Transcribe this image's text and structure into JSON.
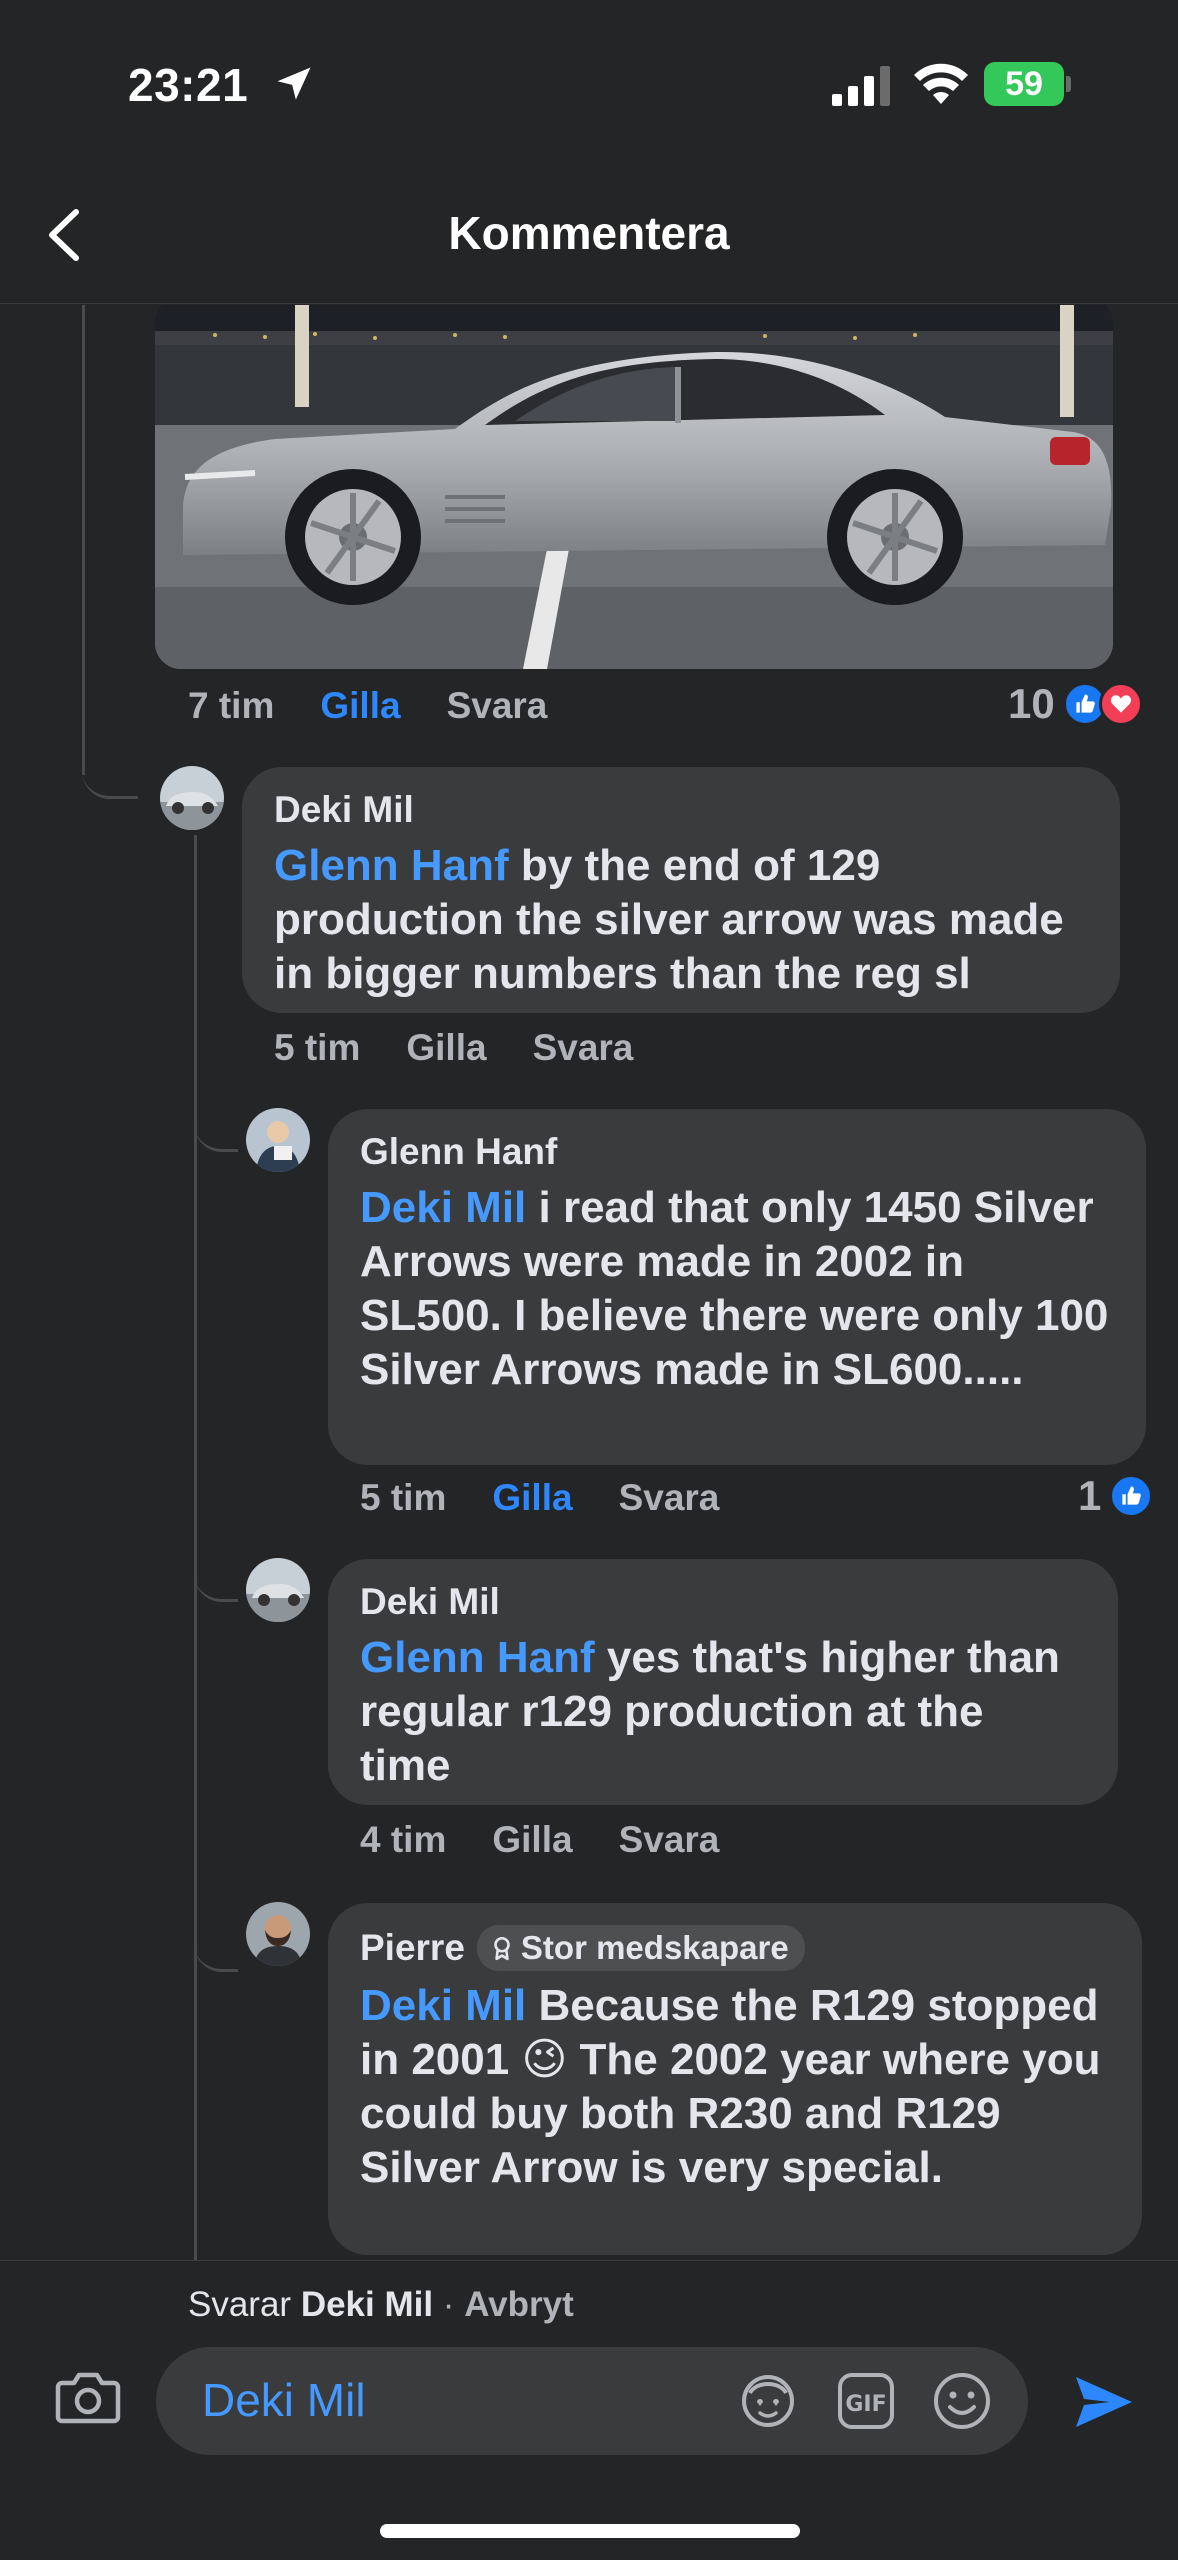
{
  "status_bar": {
    "time": "23:21",
    "battery": "59"
  },
  "header": {
    "title": "Kommentera"
  },
  "comments": [
    {
      "time": "7 tim",
      "like_label": "Gilla",
      "reply_label": "Svara",
      "reaction_count": "10"
    },
    {
      "author": "Deki Mil",
      "mention": "Glenn Hanf",
      "text": " by the end of 129 production the silver arrow was made in bigger numbers than the reg sl",
      "time": "5 tim",
      "like_label": "Gilla",
      "reply_label": "Svara"
    },
    {
      "author": "Glenn Hanf",
      "mention": "Deki Mil",
      "text": " i read that only 1450 Silver Arrows were made in 2002 in SL500.  I believe there were only 100 Silver Arrows made in SL600.....",
      "time": "5 tim",
      "like_label": "Gilla",
      "reply_label": "Svara",
      "reaction_count": "1"
    },
    {
      "author": "Deki Mil",
      "mention": "Glenn Hanf",
      "text": " yes that's higher than regular r129 production  at the time",
      "time": "4 tim",
      "like_label": "Gilla",
      "reply_label": "Svara"
    },
    {
      "author": "Pierre",
      "badge": "Stor medskapare",
      "mention": "Deki Mil",
      "text_before_emoji": " Because the R129 stopped in 2001 ",
      "emoji": "😉",
      "text_after_emoji": " The 2002 year where you could buy both R230 and R129 Silver Arrow is very special."
    }
  ],
  "composer": {
    "reply_prefix": "Svarar ",
    "reply_name": "Deki Mil",
    "reply_separator": " · ",
    "cancel_label": "Avbryt",
    "input_value": "Deki Mil"
  },
  "colors": {
    "background": "#242526",
    "bubble": "#3a3b3c",
    "mention": "#4599ff",
    "liked": "#2d88ff",
    "battery": "#34c759"
  },
  "icons": [
    "location-arrow-icon",
    "cellular-signal-icon",
    "wifi-icon",
    "battery-icon",
    "chevron-left-icon",
    "like-reaction-icon",
    "love-reaction-icon",
    "award-icon",
    "camera-icon",
    "avatar-sticker-icon",
    "gif-icon",
    "emoji-icon",
    "send-icon"
  ]
}
